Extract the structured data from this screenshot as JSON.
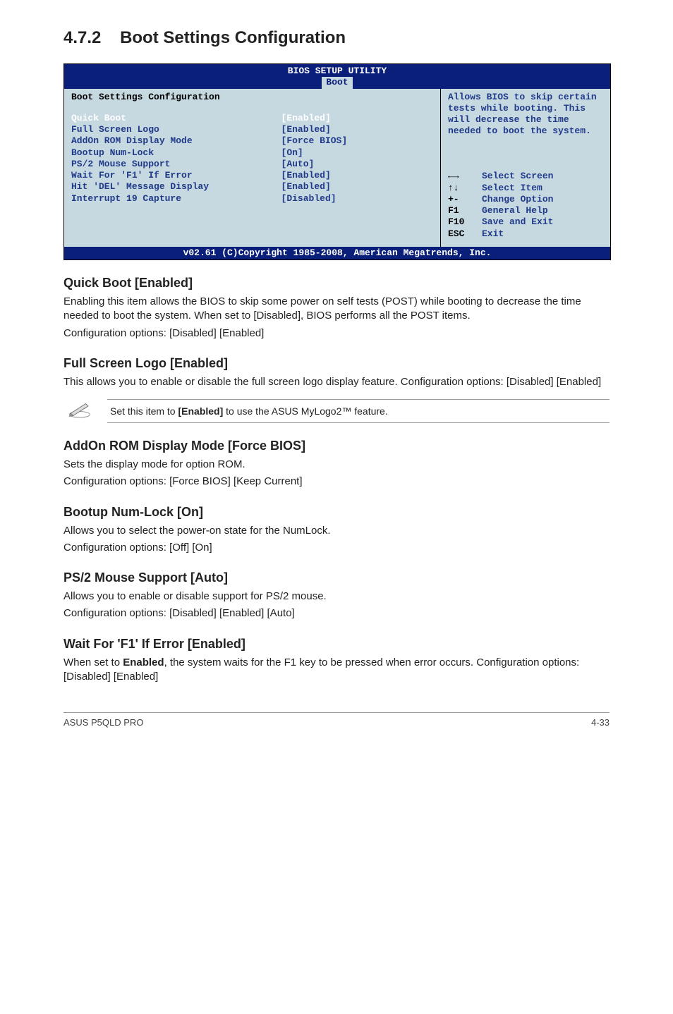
{
  "section": {
    "number": "4.7.2",
    "title": "Boot Settings Configuration"
  },
  "bios": {
    "title": "BIOS SETUP UTILITY",
    "tab": "Boot",
    "config_header": "Boot Settings Configuration",
    "rows": [
      {
        "label": "Quick Boot",
        "value": "[Enabled]",
        "selected": true
      },
      {
        "label": "Full Screen Logo",
        "value": "[Enabled]"
      },
      {
        "label": "AddOn ROM Display Mode",
        "value": "[Force BIOS]"
      },
      {
        "label": "Bootup Num-Lock",
        "value": "[On]"
      },
      {
        "label": "PS/2 Mouse Support",
        "value": "[Auto]"
      },
      {
        "label": "Wait For 'F1' If Error",
        "value": "[Enabled]"
      },
      {
        "label": "Hit 'DEL' Message Display",
        "value": "[Enabled]"
      },
      {
        "label": "Interrupt 19 Capture",
        "value": "[Disabled]"
      }
    ],
    "help": "Allows BIOS to skip certain tests while booting. This will decrease the time needed to boot the system.",
    "nav": [
      {
        "key": "←→",
        "desc": "Select Screen"
      },
      {
        "key": "↑↓",
        "desc": "Select Item"
      },
      {
        "key": "+-",
        "desc": "Change Option"
      },
      {
        "key": "F1",
        "desc": "General Help"
      },
      {
        "key": "F10",
        "desc": "Save and Exit"
      },
      {
        "key": "ESC",
        "desc": "Exit"
      }
    ],
    "footer": "v02.61 (C)Copyright 1985-2008, American Megatrends, Inc."
  },
  "content": {
    "quickboot": {
      "h": "Quick Boot [Enabled]",
      "p1": "Enabling this item allows the BIOS to skip some power on self tests (POST) while booting to decrease the time needed to boot the system. When set to [Disabled], BIOS performs all the POST items.",
      "p2": "Configuration options: [Disabled] [Enabled]"
    },
    "fullscreen": {
      "h": "Full Screen Logo [Enabled]",
      "p1": "This allows you to enable or disable the full screen logo display feature. Configuration options: [Disabled] [Enabled]"
    },
    "note": {
      "pre": "Set this item to ",
      "bold": "[Enabled]",
      "post": " to use the ASUS MyLogo2™ feature."
    },
    "addon": {
      "h": "AddOn ROM Display Mode [Force BIOS]",
      "p1": "Sets the display mode for option ROM.",
      "p2": "Configuration options: [Force BIOS] [Keep Current]"
    },
    "numlock": {
      "h": "Bootup Num-Lock [On]",
      "p1": "Allows you to select the power-on state for the NumLock.",
      "p2": "Configuration options: [Off] [On]"
    },
    "ps2": {
      "h": "PS/2 Mouse Support [Auto]",
      "p1": "Allows you to enable or disable support for PS/2 mouse.",
      "p2": "Configuration options: [Disabled] [Enabled] [Auto]"
    },
    "waitf1": {
      "h": "Wait For 'F1' If Error [Enabled]",
      "p_pre": "When set to ",
      "p_bold": "Enabled",
      "p_post": ", the system waits for the F1 key to be pressed when error occurs. Configuration options: [Disabled] [Enabled]"
    }
  },
  "footer": {
    "left": "ASUS P5QLD PRO",
    "right": "4-33"
  }
}
